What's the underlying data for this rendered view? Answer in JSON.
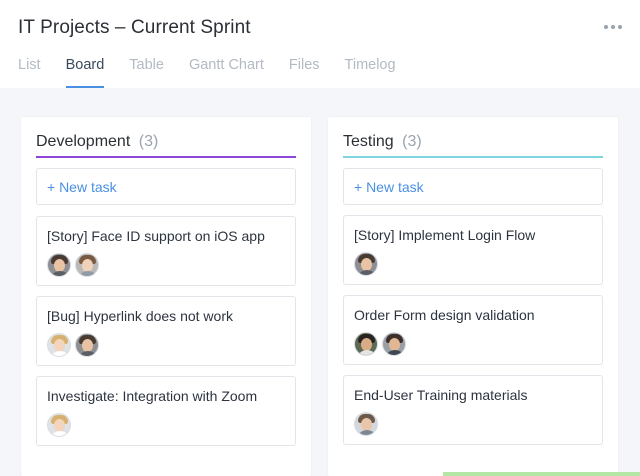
{
  "header": {
    "title": "IT Projects – Current Sprint",
    "more_icon": "more-horizontal-icon"
  },
  "tabs": [
    {
      "label": "List",
      "active": false
    },
    {
      "label": "Board",
      "active": true
    },
    {
      "label": "Table",
      "active": false
    },
    {
      "label": "Gantt Chart",
      "active": false
    },
    {
      "label": "Files",
      "active": false
    },
    {
      "label": "Timelog",
      "active": false
    }
  ],
  "columns": [
    {
      "name": "Development",
      "count": "(3)",
      "color": "#8e45d8",
      "new_task_label": "+ New task",
      "cards": [
        {
          "title": "[Story] Face ID support on iOS app",
          "avatars": [
            "avatar",
            "avatar"
          ]
        },
        {
          "title": "[Bug] Hyperlink does not work",
          "avatars": [
            "avatar",
            "avatar"
          ]
        },
        {
          "title": "Investigate: Integration with Zoom",
          "avatars": [
            "avatar"
          ]
        }
      ]
    },
    {
      "name": "Testing",
      "count": "(3)",
      "color": "#7ed6e0",
      "new_task_label": "+ New task",
      "cards": [
        {
          "title": "[Story] Implement Login Flow",
          "avatars": [
            "avatar"
          ]
        },
        {
          "title": "Order Form design validation",
          "avatars": [
            "avatar",
            "avatar"
          ]
        },
        {
          "title": "End-User Training materials",
          "avatars": [
            "avatar"
          ]
        }
      ]
    }
  ],
  "colors": {
    "accent": "#4a90e2",
    "tab_inactive": "#b3bac3",
    "background": "#f4f6f9"
  }
}
